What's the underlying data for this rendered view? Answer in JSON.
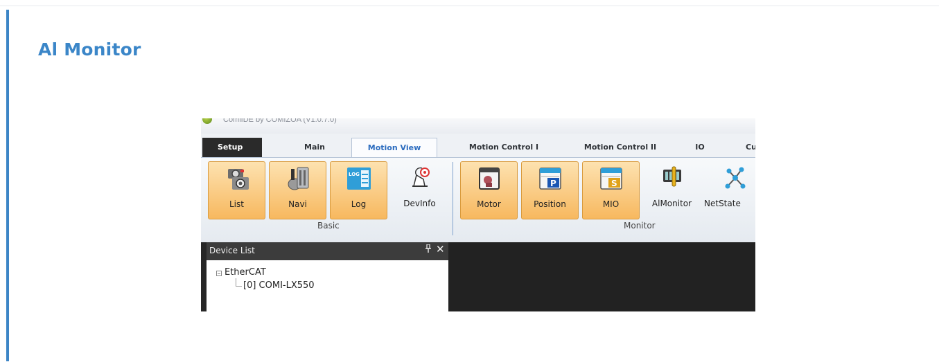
{
  "page": {
    "title": "Al Monitor"
  },
  "app": {
    "title": "ComiIDE by COMIZOA (V1.0.7.0)"
  },
  "tabs": [
    {
      "label": "Setup"
    },
    {
      "label": "Main"
    },
    {
      "label": "Motion View"
    },
    {
      "label": "Motion Control I"
    },
    {
      "label": "Motion Control II"
    },
    {
      "label": "IO"
    },
    {
      "label": "Cu"
    }
  ],
  "ribbon": {
    "groups": {
      "basic": "Basic",
      "monitor": "Monitor"
    },
    "buttons": [
      {
        "label": "List",
        "icon": "camera-gear-icon"
      },
      {
        "label": "Navi",
        "icon": "navi-icon"
      },
      {
        "label": "Log",
        "icon": "log-icon"
      },
      {
        "label": "DevInfo",
        "icon": "devinfo-icon"
      },
      {
        "label": "Motor",
        "icon": "motor-icon"
      },
      {
        "label": "Position",
        "icon": "position-icon"
      },
      {
        "label": "MIO",
        "icon": "mio-icon"
      },
      {
        "label": "AlMonitor",
        "icon": "almonitor-icon"
      },
      {
        "label": "NetState",
        "icon": "network-icon"
      }
    ],
    "icon_texts": {
      "log": "LOG",
      "position": "P",
      "mio": "S"
    }
  },
  "device_list": {
    "title": "Device List",
    "pin": "📌",
    "close": "✕",
    "expander": "−",
    "root": "EtherCAT",
    "child": "[0] COMI-LX550"
  },
  "colors": {
    "accent": "#3b86c8",
    "active_button": "#f7b85f",
    "tab_active_text": "#2c6cbf"
  }
}
